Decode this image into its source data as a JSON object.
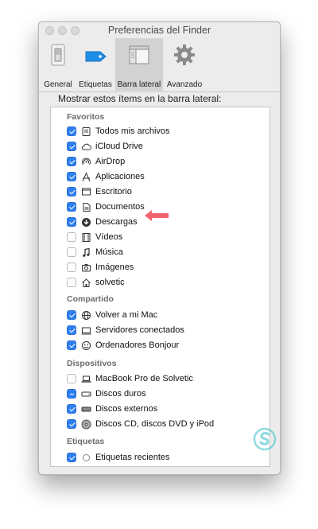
{
  "window": {
    "title": "Preferencias del Finder"
  },
  "toolbar": {
    "tabs": [
      {
        "label": "General"
      },
      {
        "label": "Etiquetas"
      },
      {
        "label": "Barra lateral"
      },
      {
        "label": "Avanzado"
      }
    ],
    "selected": "Barra lateral"
  },
  "panel": {
    "heading": "Mostrar estos ítems en la barra lateral:"
  },
  "sections": {
    "favoritos": {
      "title": "Favoritos",
      "items": [
        {
          "label": "Todos mis archivos",
          "checked": true,
          "icon": "all-files-icon"
        },
        {
          "label": "iCloud Drive",
          "checked": true,
          "icon": "cloud-icon"
        },
        {
          "label": "AirDrop",
          "checked": true,
          "icon": "airdrop-icon"
        },
        {
          "label": "Aplicaciones",
          "checked": true,
          "icon": "applications-icon"
        },
        {
          "label": "Escritorio",
          "checked": true,
          "icon": "desktop-icon"
        },
        {
          "label": "Documentos",
          "checked": true,
          "icon": "documents-icon"
        },
        {
          "label": "Descargas",
          "checked": true,
          "icon": "downloads-icon"
        },
        {
          "label": "Vídeos",
          "checked": false,
          "icon": "film-icon"
        },
        {
          "label": "Música",
          "checked": false,
          "icon": "music-icon"
        },
        {
          "label": "Imágenes",
          "checked": false,
          "icon": "camera-icon"
        },
        {
          "label": "solvetic",
          "checked": false,
          "icon": "home-icon"
        }
      ]
    },
    "compartido": {
      "title": "Compartido",
      "items": [
        {
          "label": "Volver a mi Mac",
          "checked": true,
          "icon": "back-to-my-mac-icon"
        },
        {
          "label": "Servidores conectados",
          "checked": true,
          "icon": "server-icon"
        },
        {
          "label": "Ordenadores Bonjour",
          "checked": true,
          "icon": "bonjour-icon"
        }
      ]
    },
    "dispositivos": {
      "title": "Dispositivos",
      "items": [
        {
          "label": "MacBook Pro de Solvetic",
          "checked": false,
          "icon": "laptop-icon"
        },
        {
          "label": "Discos duros",
          "checked": "mixed",
          "icon": "hard-disk-icon"
        },
        {
          "label": "Discos externos",
          "checked": true,
          "icon": "external-disk-icon"
        },
        {
          "label": "Discos CD, discos DVD y iPod",
          "checked": true,
          "icon": "cd-icon"
        }
      ]
    },
    "etiquetas": {
      "title": "Etiquetas",
      "items": [
        {
          "label": "Etiquetas recientes",
          "checked": true,
          "icon": "tag-circle-icon"
        }
      ]
    }
  },
  "annotation": {
    "arrow_color": "#f0646e",
    "points_to": "Descargas"
  },
  "colors": {
    "checkbox_accent": "#2e7ff0",
    "logo_accent": "#3bbfc6"
  }
}
